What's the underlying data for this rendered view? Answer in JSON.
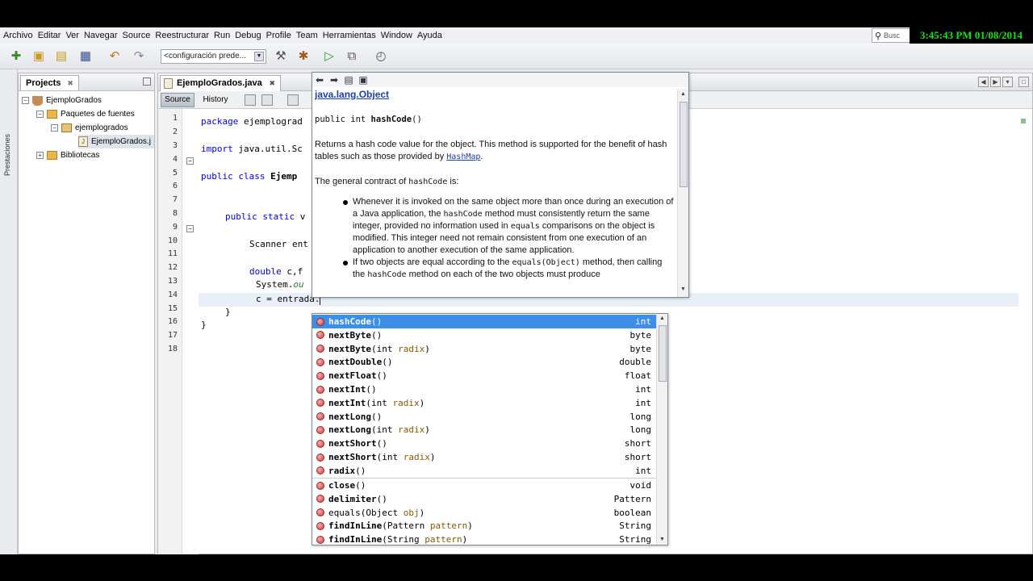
{
  "menu": [
    "Archivo",
    "Editar",
    "Ver",
    "Navegar",
    "Source",
    "Reestructurar",
    "Run",
    "Debug",
    "Profile",
    "Team",
    "Herramientas",
    "Window",
    "Ayuda"
  ],
  "search": {
    "placeholder": "Busc"
  },
  "clock": "3:45:43 PM 01/08/2014",
  "toolbar": {
    "config": "<configuración prede..."
  },
  "left_strip": {
    "label": "Prestaciones"
  },
  "projects": {
    "tab": "Projects",
    "close": "✖",
    "tree": {
      "project": "EjemploGrados",
      "sources": "Paquetes de fuentes",
      "package": "ejemplogrados",
      "file": "EjemploGrados.j",
      "libraries": "Bibliotecas"
    }
  },
  "editor": {
    "tab": "EjemploGrados.java",
    "close": "✖",
    "source_btn": "Source",
    "history_btn": "History",
    "line_numbers": [
      "1",
      "2",
      "3",
      "4",
      "5",
      "6",
      "7",
      "8",
      "9",
      "10",
      "11",
      "12",
      "13",
      "14",
      "15",
      "16",
      "17",
      "18"
    ],
    "code": {
      "l3_kw": "package",
      "l3_rest": " ejemplograd",
      "l4_kw": "import",
      "l4_rest": " java.util.Sc",
      "l6_kw": "public class",
      "l6_rest": " Ejemp",
      "l9_kw": "public static",
      "l9_rest": " v",
      "l11": "Scanner ent",
      "l13_kw": "double",
      "l13_rest": " c,f",
      "l14a": "System.",
      "l14b": "ou",
      "l15": "c = entrada.",
      "l16": "}",
      "l17": "}"
    }
  },
  "javadoc": {
    "class": "java.lang.Object",
    "sig_prefix": "public int ",
    "sig_name": "hashCode",
    "sig_suffix": "()",
    "p1a": "Returns a hash code value for the object. This method is supported for the benefit of hash tables such as those provided by ",
    "p1_link": "HashMap",
    "p1b": ".",
    "p2a": "The general contract of ",
    "p2_code": "hashCode",
    "p2b": " is:",
    "b1a": "Whenever it is invoked on the same object more than once during an execution of a Java application, the ",
    "b1_code": "hashCode",
    "b1b": " method must consistently return the same integer, provided no information used in ",
    "b1_code2": "equals",
    "b1c": " comparisons on the object is modified. This integer need not remain consistent from one execution of an application to another execution of the same application.",
    "b2a": "If two objects are equal according to the ",
    "b2_code": "equals(Object)",
    "b2b": " method, then calling the ",
    "b2_code2": "hashCode",
    "b2c": " method on each of the two objects must produce"
  },
  "completion": [
    {
      "name": "hashCode",
      "params": "()",
      "ret": "int"
    },
    {
      "name": "nextByte",
      "params": "()",
      "ret": "byte"
    },
    {
      "name": "nextByte",
      "params_a": "(int ",
      "params_b": "radix",
      "params_c": ")",
      "ret": "byte"
    },
    {
      "name": "nextDouble",
      "params": "()",
      "ret": "double"
    },
    {
      "name": "nextFloat",
      "params": "()",
      "ret": "float"
    },
    {
      "name": "nextInt",
      "params": "()",
      "ret": "int"
    },
    {
      "name": "nextInt",
      "params_a": "(int ",
      "params_b": "radix",
      "params_c": ")",
      "ret": "int"
    },
    {
      "name": "nextLong",
      "params": "()",
      "ret": "long"
    },
    {
      "name": "nextLong",
      "params_a": "(int ",
      "params_b": "radix",
      "params_c": ")",
      "ret": "long"
    },
    {
      "name": "nextShort",
      "params": "()",
      "ret": "short"
    },
    {
      "name": "nextShort",
      "params_a": "(int ",
      "params_b": "radix",
      "params_c": ")",
      "ret": "short"
    },
    {
      "name": "radix",
      "params": "()",
      "ret": "int"
    },
    {
      "name": "close",
      "params": "()",
      "ret": "void"
    },
    {
      "name": "delimiter",
      "params": "()",
      "ret": "Pattern"
    },
    {
      "name": "equals",
      "params_a": "(Object ",
      "params_b": "obj",
      "params_c": ")",
      "ret": "boolean",
      "plain": true
    },
    {
      "name": "findInLine",
      "params_a": "(Pattern ",
      "params_b": "pattern",
      "params_c": ")",
      "ret": "String"
    },
    {
      "name": "findInLine",
      "params_a": "(String ",
      "params_b": "pattern",
      "params_c": ")",
      "ret": "String"
    }
  ],
  "colors": {
    "selection": "#3d8ee9",
    "clock_text": "#19e019",
    "keyword": "#0000e6"
  }
}
